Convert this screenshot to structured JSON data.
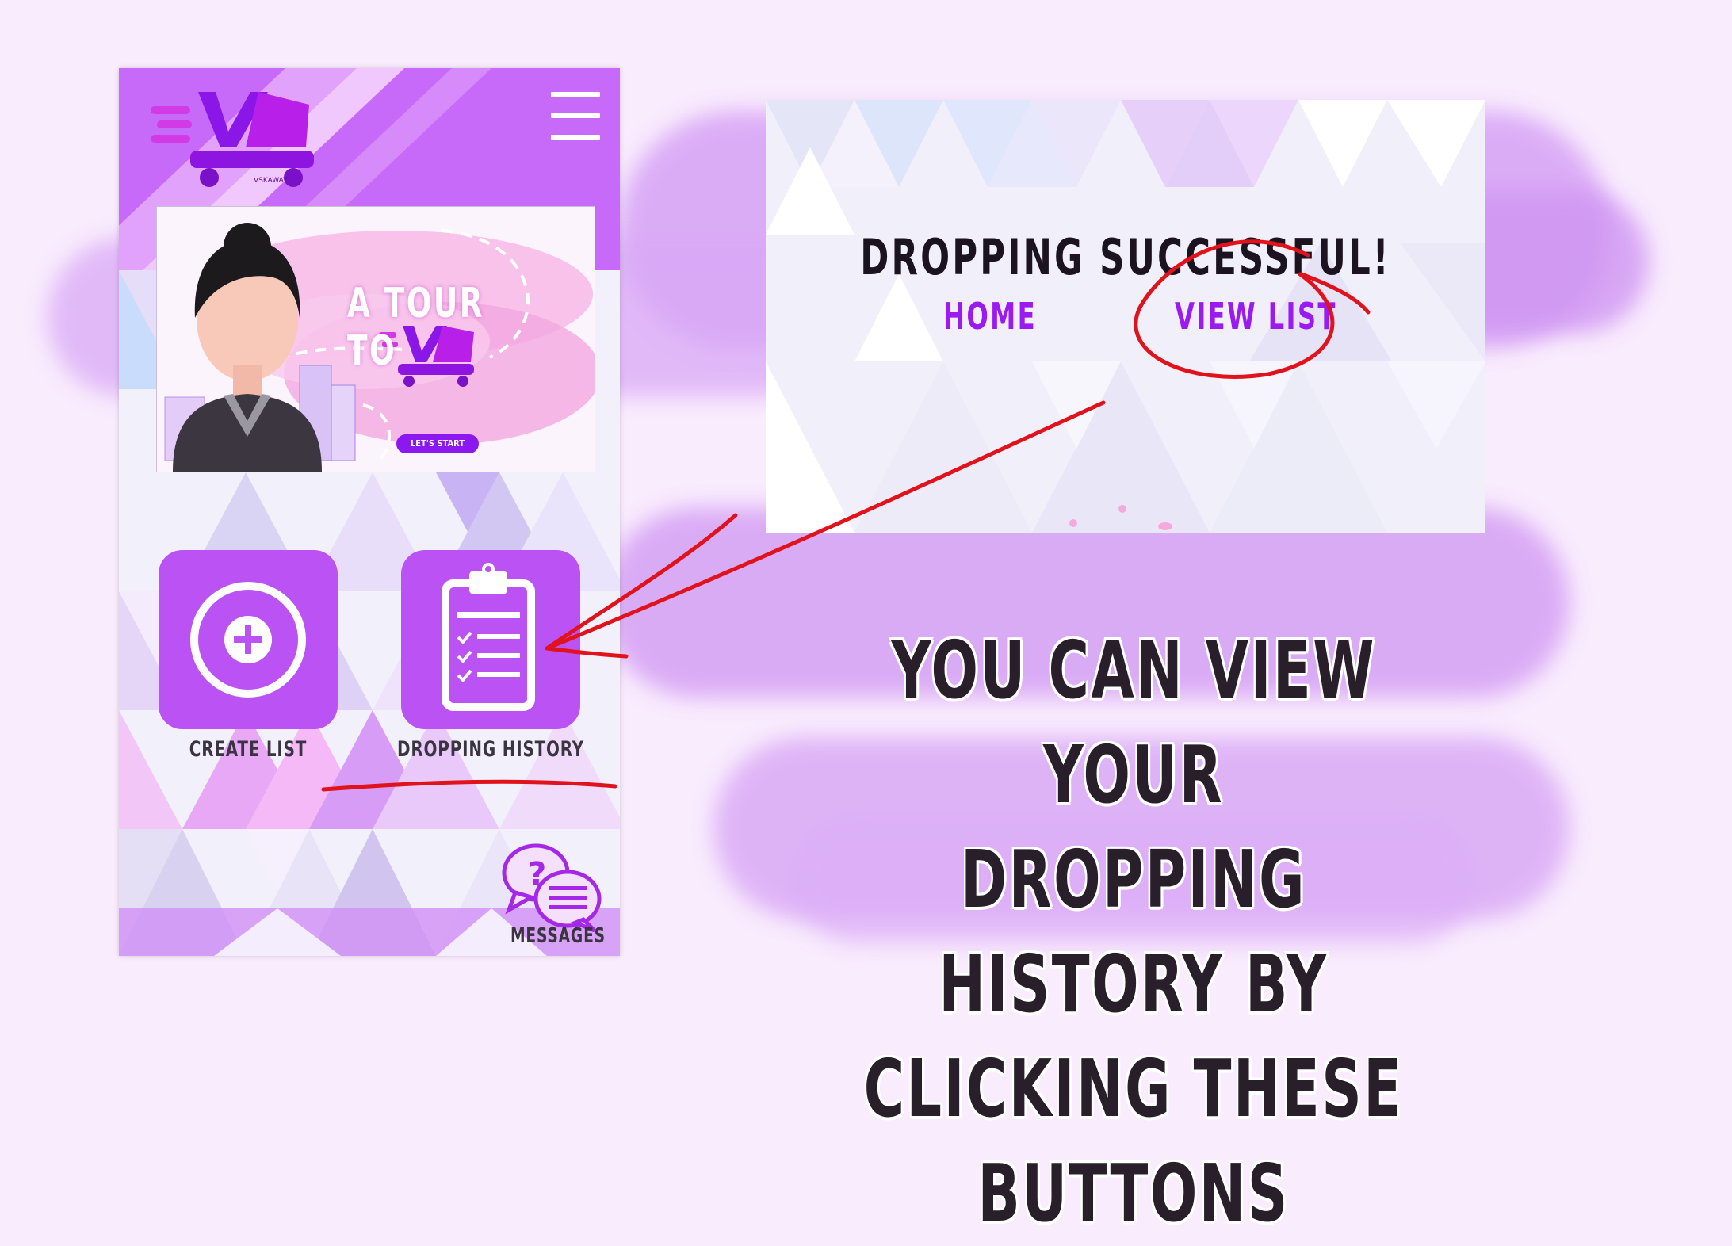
{
  "phone": {
    "banner": {
      "title": "A TOUR TO",
      "start_label": "LET'S START"
    },
    "buttons": [
      {
        "label": "CREATE LIST"
      },
      {
        "label": "DROPPING HISTORY"
      }
    ],
    "messages_label": "MESSAGES"
  },
  "card": {
    "title": "DROPPING SUCCESSFUL!",
    "home_label": "HOME",
    "view_list_label": "VIEW LIST"
  },
  "headline": {
    "line1": "YOU CAN VIEW YOUR",
    "line2": "DROPPING HISTORY BY",
    "line3": "CLICKING THESE BUTTONS"
  },
  "colors": {
    "accent_purple": "#bb52f4",
    "link_purple": "#9b1aef",
    "annotation_red": "#e0121b",
    "background": "#f9ecfd"
  }
}
